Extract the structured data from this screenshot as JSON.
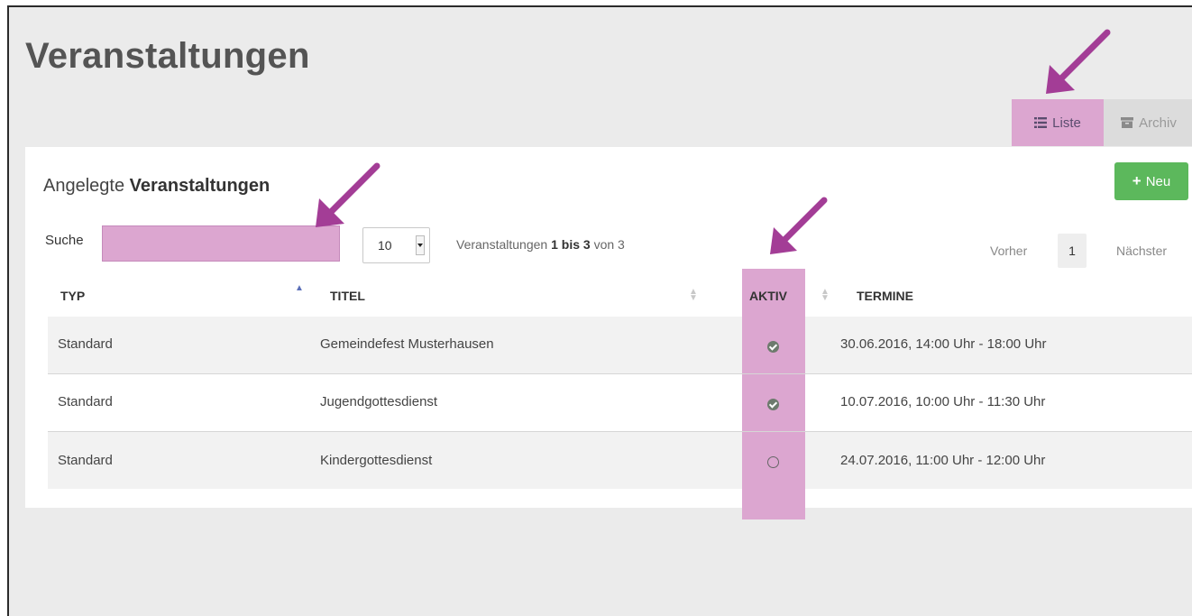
{
  "page": {
    "title": "Veranstaltungen"
  },
  "view_tabs": [
    {
      "label": "Liste",
      "icon": "list-icon",
      "active": true
    },
    {
      "label": "Archiv",
      "icon": "archive-icon",
      "active": false
    }
  ],
  "panel": {
    "heading_light": "Angelegte ",
    "heading_bold": "Veranstaltungen",
    "new_button_label": "Neu"
  },
  "controls": {
    "search_label": "Suche",
    "search_value": "",
    "page_length": "10",
    "info_prefix": "Veranstaltungen ",
    "info_range": "1 bis 3",
    "info_suffix": " von 3"
  },
  "pager": {
    "prev_label": "Vorher",
    "current_page": "1",
    "next_label": "Nächster"
  },
  "table": {
    "columns": [
      "TYP",
      "TITEL",
      "AKTIV",
      "TERMINE"
    ],
    "rows": [
      {
        "typ": "Standard",
        "titel": "Gemeindefest Musterhausen",
        "aktiv": true,
        "termine": "30.06.2016, 14:00 Uhr - 18:00 Uhr"
      },
      {
        "typ": "Standard",
        "titel": "Jugendgottesdienst",
        "aktiv": true,
        "termine": "10.07.2016, 10:00 Uhr - 11:30 Uhr"
      },
      {
        "typ": "Standard",
        "titel": "Kindergottesdienst",
        "aktiv": false,
        "termine": "24.07.2016, 11:00 Uhr - 12:00 Uhr"
      }
    ]
  },
  "colors": {
    "highlight": "#dca6d0",
    "annotation_arrow": "#a33d96",
    "new_button": "#5cb85c",
    "sort_active": "#5b6fb8"
  }
}
